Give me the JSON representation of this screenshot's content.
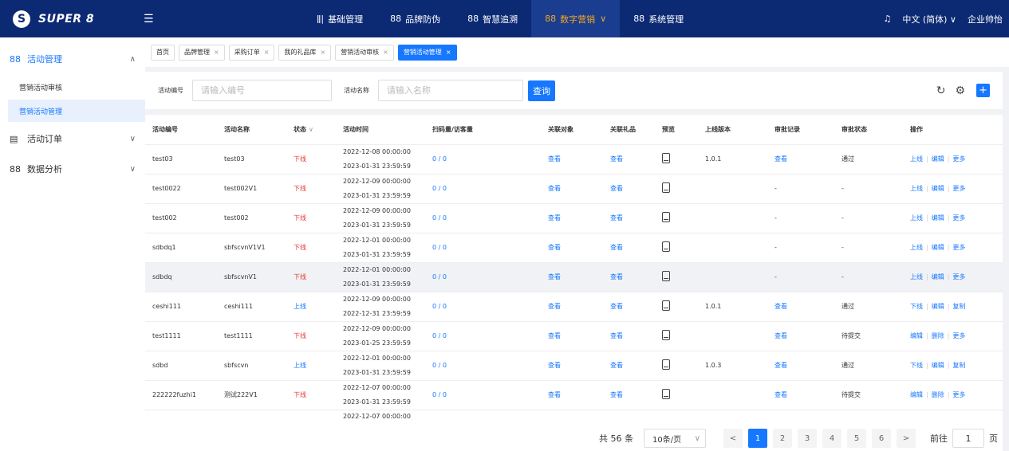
{
  "brand": {
    "logo_text": "SUPER 8"
  },
  "topnav": [
    {
      "icon": "ǁ|",
      "label": "基础管理"
    },
    {
      "icon": "88",
      "label": "品牌防伪"
    },
    {
      "icon": "88",
      "label": "智慧追溯"
    },
    {
      "icon": "88",
      "label": "数字营销",
      "chev": "∨"
    },
    {
      "icon": "88",
      "label": "系统管理"
    }
  ],
  "topright": {
    "bell": "♫",
    "language": "中文 (简体) ∨",
    "user": "企业帅怡"
  },
  "sidebar": {
    "group1": {
      "label": "活动管理",
      "chev": "∧"
    },
    "sub1": "营销活动审核",
    "sub2": "营销活动管理",
    "group2": {
      "label": "活动订单",
      "chev": "∨"
    },
    "group3": {
      "label": "数据分析",
      "chev": "∨"
    }
  },
  "tabs": [
    "首页",
    "品牌管理",
    "采购订单",
    "我的礼品库",
    "营销活动审核",
    "营销活动管理"
  ],
  "filter": {
    "code_label": "活动编号",
    "code_placeholder": "请输入编号",
    "name_label": "活动名称",
    "name_placeholder": "请输入名称",
    "query_button": "查询"
  },
  "table": {
    "headers": [
      "活动编号",
      "活动名称",
      "状态",
      "活动时间",
      "扫码量/访客量",
      "关联对象",
      "关联礼品",
      "预览",
      "上线版本",
      "审批记录",
      "审批状态",
      "操作"
    ],
    "status_sort": "∨",
    "rows": [
      {
        "code": "test03",
        "name": "test03",
        "status": "下线",
        "start": "2022-12-08 00:00:00",
        "end": "2023-01-31 23:59:59",
        "scan": "0 / 0",
        "obj": "查看",
        "gift": "查看",
        "version": "1.0.1",
        "record": "查看",
        "approval": "通过",
        "ops": [
          "上线",
          "编辑",
          "更多"
        ]
      },
      {
        "code": "test0022",
        "name": "test002V1",
        "status": "下线",
        "start": "2022-12-09 00:00:00",
        "end": "2023-01-31 23:59:59",
        "scan": "0 / 0",
        "obj": "查看",
        "gift": "查看",
        "version": "",
        "record": "-",
        "approval": "-",
        "ops": [
          "上线",
          "编辑",
          "更多"
        ]
      },
      {
        "code": "test002",
        "name": "test002",
        "status": "下线",
        "start": "2022-12-09 00:00:00",
        "end": "2023-01-31 23:59:59",
        "scan": "0 / 0",
        "obj": "查看",
        "gift": "查看",
        "version": "",
        "record": "-",
        "approval": "-",
        "ops": [
          "上线",
          "编辑",
          "更多"
        ]
      },
      {
        "code": "sdbdq1",
        "name": "sbfscvnV1V1",
        "status": "下线",
        "start": "2022-12-01 00:00:00",
        "end": "2023-01-31 23:59:59",
        "scan": "0 / 0",
        "obj": "查看",
        "gift": "查看",
        "version": "",
        "record": "-",
        "approval": "-",
        "ops": [
          "上线",
          "编辑",
          "更多"
        ]
      },
      {
        "code": "sdbdq",
        "name": "sbfscvnV1",
        "status": "下线",
        "start": "2022-12-01 00:00:00",
        "end": "2023-01-31 23:59:59",
        "scan": "0 / 0",
        "obj": "查看",
        "gift": "查看",
        "version": "",
        "record": "-",
        "approval": "-",
        "ops": [
          "上线",
          "编辑",
          "更多"
        ]
      },
      {
        "code": "ceshi111",
        "name": "ceshi111",
        "status": "上线",
        "start": "2022-12-09 00:00:00",
        "end": "2022-12-31 23:59:59",
        "scan": "0 / 0",
        "obj": "查看",
        "gift": "查看",
        "version": "1.0.1",
        "record": "查看",
        "approval": "通过",
        "ops": [
          "下线",
          "编辑",
          "复制"
        ]
      },
      {
        "code": "test1111",
        "name": "test1111",
        "status": "下线",
        "start": "2022-12-09 00:00:00",
        "end": "2023-01-25 23:59:59",
        "scan": "0 / 0",
        "obj": "查看",
        "gift": "查看",
        "version": "",
        "record": "查看",
        "approval": "待提交",
        "ops": [
          "编辑",
          "删除",
          "更多"
        ]
      },
      {
        "code": "sdbd",
        "name": "sbfscvn",
        "status": "上线",
        "start": "2022-12-01 00:00:00",
        "end": "2023-01-31 23:59:59",
        "scan": "0 / 0",
        "obj": "查看",
        "gift": "查看",
        "version": "1.0.3",
        "record": "查看",
        "approval": "通过",
        "ops": [
          "下线",
          "编辑",
          "复制"
        ]
      },
      {
        "code": "222222fuzhi1",
        "name": "测试222V1",
        "status": "下线",
        "start": "2022-12-07 00:00:00",
        "end": "2023-01-31 23:59:59",
        "scan": "0 / 0",
        "obj": "查看",
        "gift": "查看",
        "version": "",
        "record": "查看",
        "approval": "待提交",
        "ops": [
          "编辑",
          "删除",
          "更多"
        ]
      }
    ],
    "partial_time": "2022-12-07 00:00:00"
  },
  "pager": {
    "total": "共 56 条",
    "size": "10条/页",
    "size_chev": "∨",
    "prev": "<",
    "pages": [
      "1",
      "2",
      "3",
      "4",
      "5",
      "6"
    ],
    "next": ">",
    "goto_label": "前往",
    "goto_value": "1",
    "goto_unit": "页"
  },
  "colors": {
    "header_bg": "#0c2a73",
    "accent": "#1677ff",
    "offline": "#e53935",
    "nav_active": "#f5a623"
  }
}
